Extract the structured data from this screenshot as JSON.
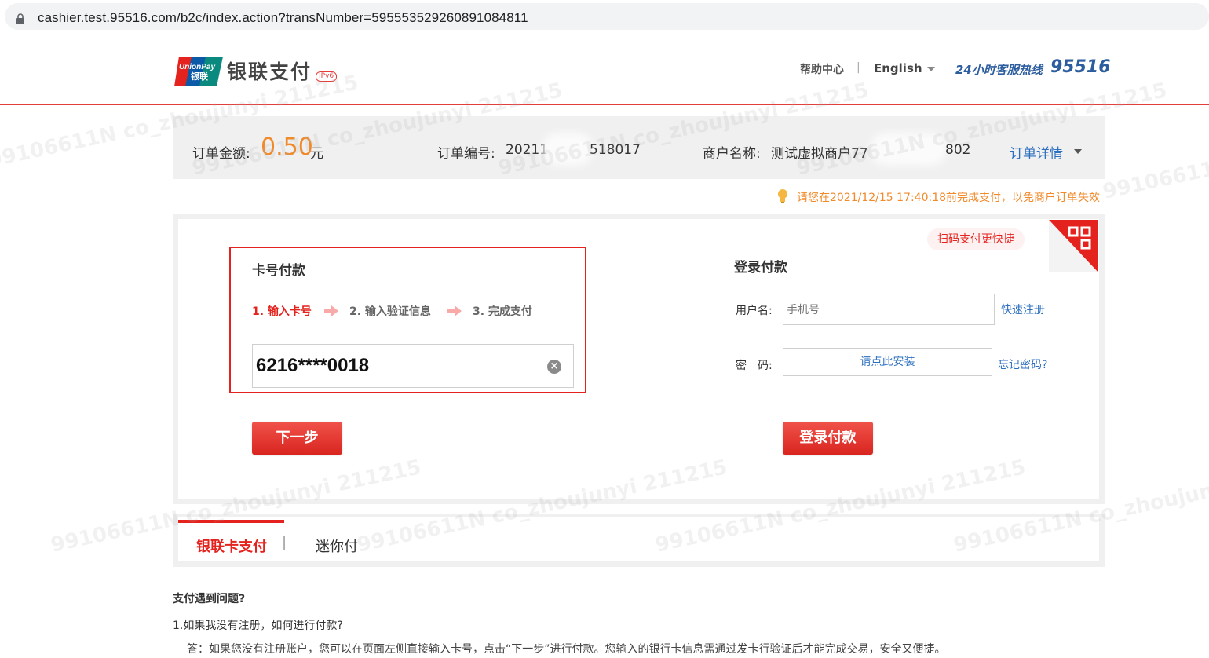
{
  "browser": {
    "url": "cashier.test.95516.com/b2c/index.action?transNumber=595553529260891084811"
  },
  "header": {
    "logo_text_top": "UnionPay",
    "logo_text_bottom": "银联",
    "brand": "银联支付",
    "ipv6": "IPv6",
    "help": "帮助中心",
    "separator": "|",
    "language": "English",
    "hotline_label": "24小时客服热线",
    "hotline_number": "95516"
  },
  "order": {
    "amount_label": "订单金额:",
    "amount": "0.50",
    "currency": "元",
    "number_label": "订单编号:",
    "number_prefix": "202112",
    "number_suffix": "518017",
    "merchant_label": "商户名称:",
    "merchant_prefix": "测试虚拟商户77",
    "merchant_suffix": "802",
    "detail_link": "订单详情"
  },
  "notice": "请您在2021/12/15 17:40:18前完成支付，以免商户订单失效",
  "card_pay": {
    "title": "卡号付款",
    "steps": [
      "1. 输入卡号",
      "2. 输入验证信息",
      "3. 完成支付"
    ],
    "card_number": "6216****0018",
    "next_button": "下一步"
  },
  "qr": {
    "tip": "扫码支付更快捷"
  },
  "login_pay": {
    "title": "登录付款",
    "username_label": "用户名:",
    "username_placeholder": "手机号",
    "register_link": "快速注册",
    "password_label": "密　码:",
    "password_install": "请点此安装",
    "forgot_link": "忘记密码?",
    "login_button": "登录付款"
  },
  "tabs": {
    "active": "银联卡支付",
    "separator": "|",
    "other": "迷你付"
  },
  "faq": {
    "title": "支付遇到问题?",
    "q1": "1.如果我没有注册，如何进行付款?",
    "a1": "答：如果您没有注册账户，您可以在页面左侧直接输入卡号，点击“下一步”进行付款。您输入的银行卡信息需通过发卡行验证后才能完成交易，安全又便捷。"
  },
  "watermark": "99106611N co_zhoujunyi 211215",
  "colors": {
    "brand_red": "#e4231e",
    "amount_orange": "#f08a2b",
    "link_blue": "#2c6fbf",
    "hotline_blue": "#2c5d9e"
  }
}
